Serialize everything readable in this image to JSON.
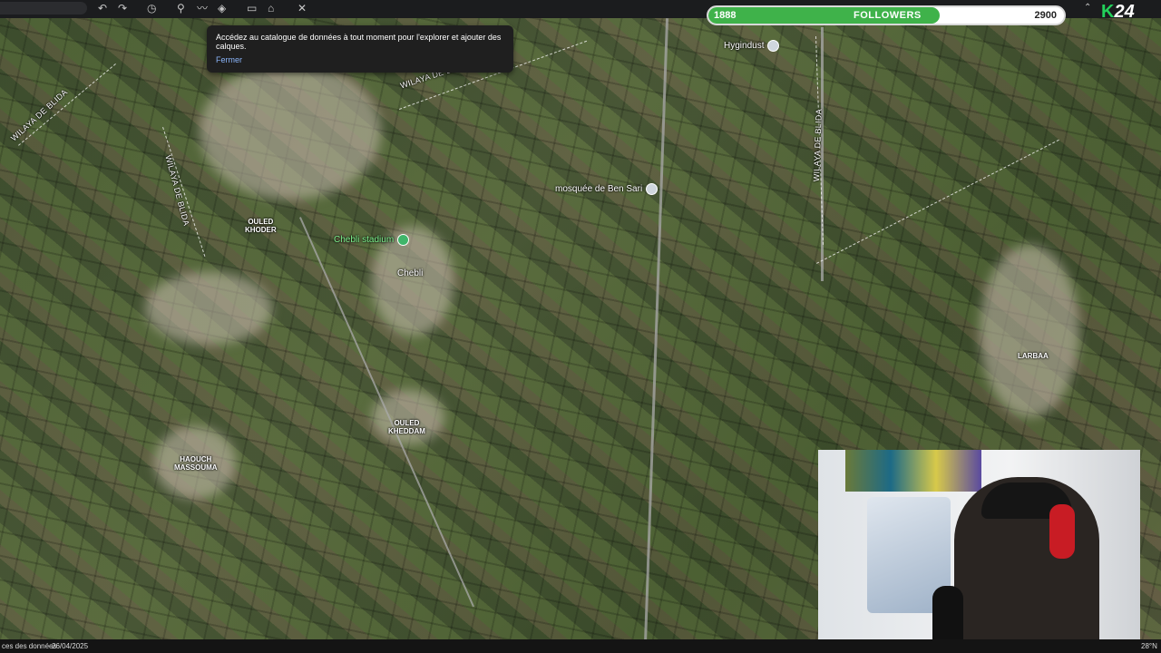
{
  "toolbar": {
    "icons": [
      "undo-icon",
      "redo-icon",
      "history-icon",
      "placemark-icon",
      "path-icon",
      "layers-icon",
      "ruler-icon",
      "image-icon",
      "measure-icon"
    ]
  },
  "tooltip": {
    "message": "Accédez au catalogue de données à tout moment pour l'explorer et ajouter des calques.",
    "close_label": "Fermer"
  },
  "followers_widget": {
    "current": "1888",
    "label": "FOLLOWERS",
    "goal": "2900",
    "progress": 0.651,
    "fill_color": "#3fb24a"
  },
  "brand": {
    "k": "K",
    "num": "24"
  },
  "map": {
    "labels": {
      "wilaya_blida_1": "WILAYA DE BLIDA",
      "wilaya_blida_2": "WILAYA DE BLIDA",
      "wilaya_blida_3": "WILAYA DE BLIDA",
      "wilaya_blida_4": "WILAYA DE BLIDA"
    },
    "pois": {
      "hygindust": "Hygindust",
      "mosquee": "mosquée de Ben Sari",
      "chebli_stadium": "Chebli stadium",
      "chebli": "Chebli"
    },
    "towns": {
      "ouled_khoder": "OULED\nKHODER",
      "ouled_khedam": "OULED\nKHEDDAM",
      "haouch": "HAOUCH\nMASSOUMA",
      "larbaa": "LARBAA"
    }
  },
  "status_bar": {
    "left": "ces des données",
    "date": "26/04/2025",
    "right": "28°N"
  }
}
